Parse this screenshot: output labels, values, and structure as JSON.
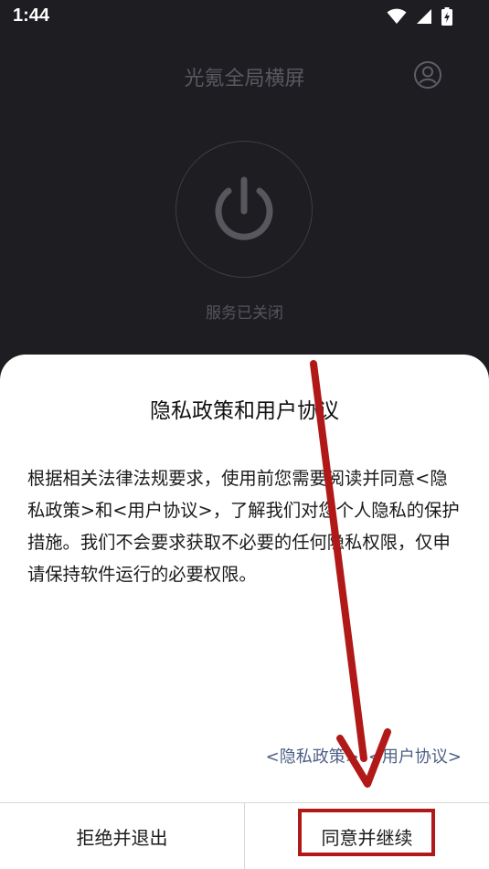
{
  "status_bar": {
    "time": "1:44",
    "icons": [
      "wifi-icon",
      "signal-icon",
      "battery-charging-icon"
    ]
  },
  "app": {
    "title": "光氪全局横屏",
    "profile_icon": "user-circle-icon",
    "power_icon": "power-icon",
    "service_status": "服务已关闭"
  },
  "dialog": {
    "title": "隐私政策和用户协议",
    "body": "根据相关法律法规要求，使用前您需要阅读并同意<隐私政策>和<用户协议>，了解我们对您个人隐私的保护措施。我们不会要求获取不必要的任何隐私权限，仅申请保持软件运行的必要权限。",
    "link_privacy": "<隐私政策>",
    "link_terms": "<用户协议>",
    "reject_label": "拒绝并退出",
    "agree_label": "同意并继续"
  },
  "colors": {
    "background": "#1e1d22",
    "link": "#4c5f85",
    "annotation": "#b11818"
  }
}
